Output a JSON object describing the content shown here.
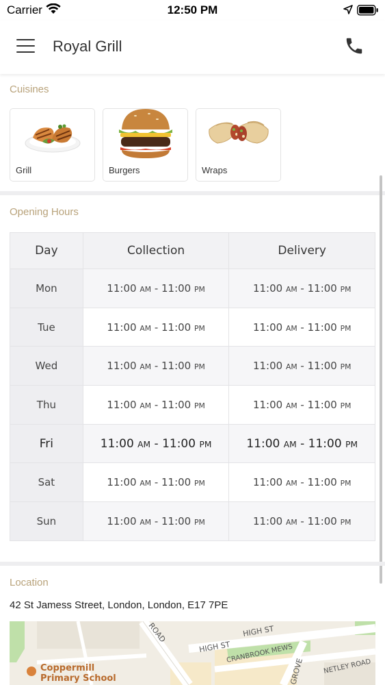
{
  "status_bar": {
    "carrier": "Carrier",
    "time": "12:50 PM"
  },
  "header": {
    "title": "Royal Grill"
  },
  "cuisines": {
    "label": "Cuisines",
    "items": [
      {
        "label": "Grill",
        "icon": "grilled-chicken-image"
      },
      {
        "label": "Burgers",
        "icon": "burger-image"
      },
      {
        "label": "Wraps",
        "icon": "wraps-image"
      }
    ]
  },
  "opening_hours": {
    "label": "Opening Hours",
    "columns": [
      "Day",
      "Collection",
      "Delivery"
    ],
    "rows": [
      {
        "day": "Mon",
        "collection": {
          "open": "11:00",
          "open_period": "AM",
          "close": "11:00",
          "close_period": "PM"
        },
        "delivery": {
          "open": "11:00",
          "open_period": "AM",
          "close": "11:00",
          "close_period": "PM"
        }
      },
      {
        "day": "Tue",
        "collection": {
          "open": "11:00",
          "open_period": "AM",
          "close": "11:00",
          "close_period": "PM"
        },
        "delivery": {
          "open": "11:00",
          "open_period": "AM",
          "close": "11:00",
          "close_period": "PM"
        }
      },
      {
        "day": "Wed",
        "collection": {
          "open": "11:00",
          "open_period": "AM",
          "close": "11:00",
          "close_period": "PM"
        },
        "delivery": {
          "open": "11:00",
          "open_period": "AM",
          "close": "11:00",
          "close_period": "PM"
        }
      },
      {
        "day": "Thu",
        "collection": {
          "open": "11:00",
          "open_period": "AM",
          "close": "11:00",
          "close_period": "PM"
        },
        "delivery": {
          "open": "11:00",
          "open_period": "AM",
          "close": "11:00",
          "close_period": "PM"
        }
      },
      {
        "day": "Fri",
        "collection": {
          "open": "11:00",
          "open_period": "AM",
          "close": "11:00",
          "close_period": "PM"
        },
        "delivery": {
          "open": "11:00",
          "open_period": "AM",
          "close": "11:00",
          "close_period": "PM"
        }
      },
      {
        "day": "Sat",
        "collection": {
          "open": "11:00",
          "open_period": "AM",
          "close": "11:00",
          "close_period": "PM"
        },
        "delivery": {
          "open": "11:00",
          "open_period": "AM",
          "close": "11:00",
          "close_period": "PM"
        }
      },
      {
        "day": "Sun",
        "collection": {
          "open": "11:00",
          "open_period": "AM",
          "close": "11:00",
          "close_period": "PM"
        },
        "delivery": {
          "open": "11:00",
          "open_period": "AM",
          "close": "11:00",
          "close_period": "PM"
        }
      }
    ],
    "highlighted_day": "Fri"
  },
  "location": {
    "label": "Location",
    "address": "42 St Jamess Street, London, London, E17 7PE",
    "map": {
      "streets": [
        "ROAD",
        "HIGH ST",
        "HIGH ST",
        "CRANBROOK MEWS",
        "NETLEY ROAD",
        "GROVE"
      ],
      "poi": "Coppermill Primary School"
    }
  },
  "colors": {
    "accent": "#b8a27a",
    "header_bg": "#ffffff",
    "table_header_bg": "#f2f2f4",
    "separator": "#eeeef0"
  }
}
